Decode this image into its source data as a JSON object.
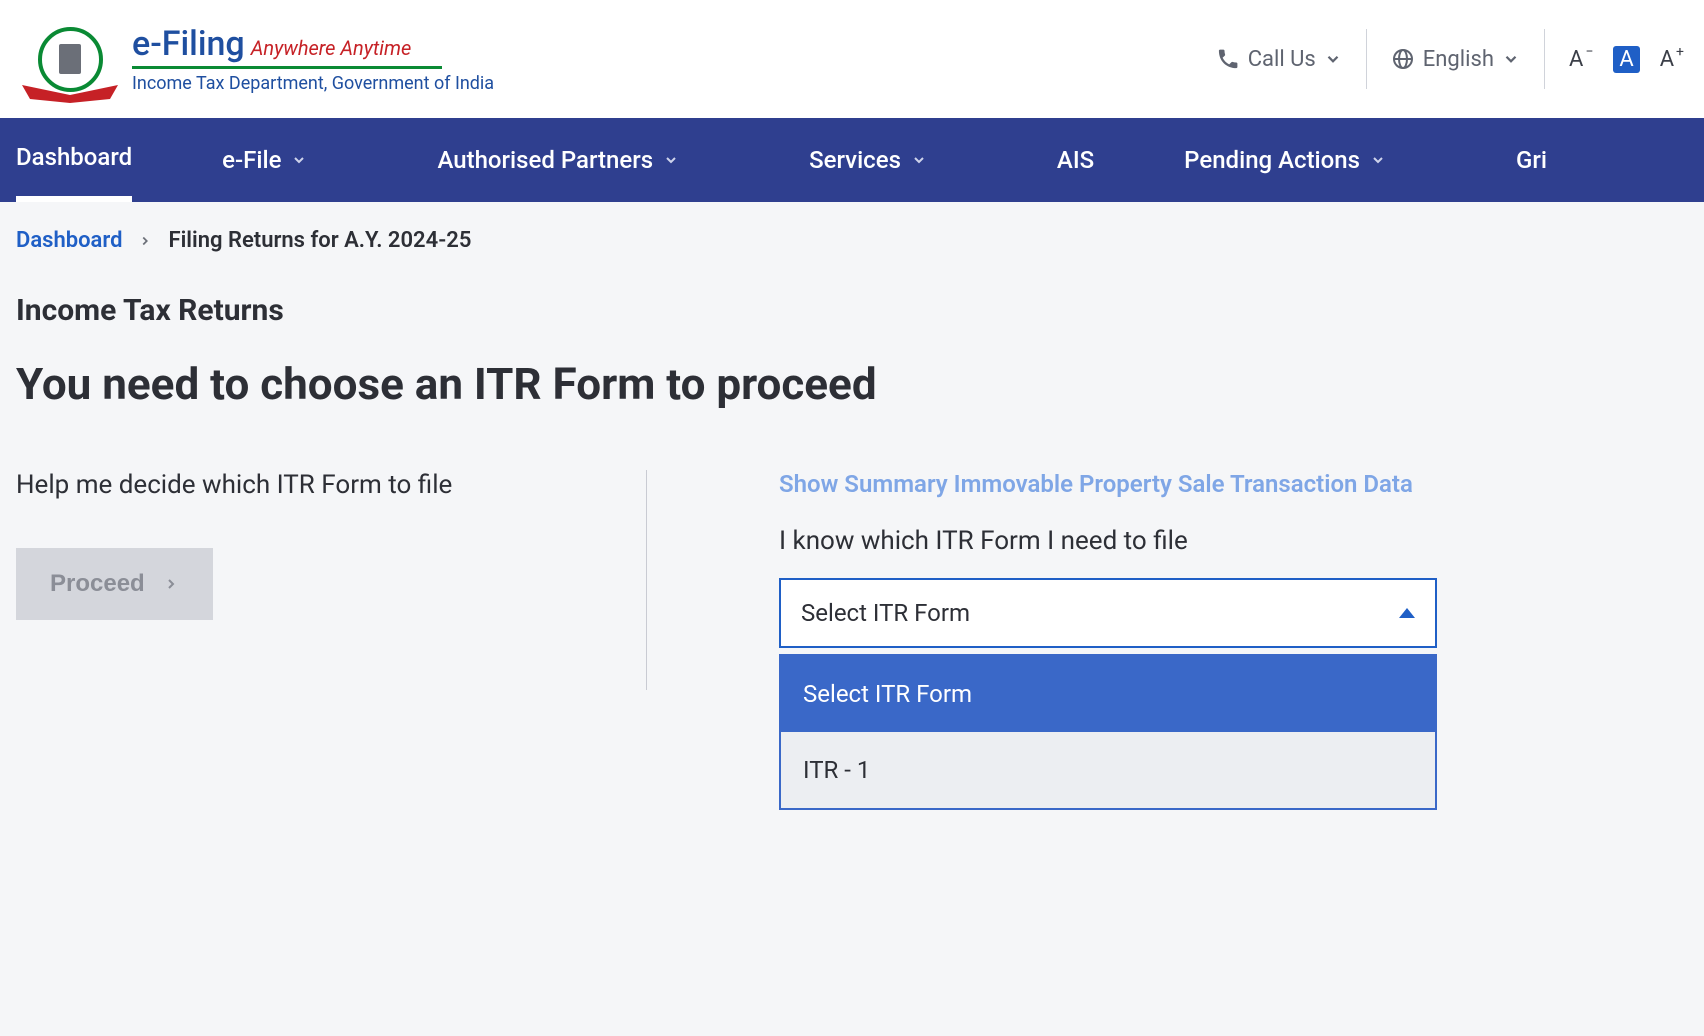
{
  "header": {
    "title_main": "e-Filing",
    "title_tagline": "Anywhere Anytime",
    "subtitle": "Income Tax Department, Government of India",
    "call_us": "Call Us",
    "language": "English",
    "font_small": "A",
    "font_normal": "A",
    "font_large": "A"
  },
  "nav": {
    "dashboard": "Dashboard",
    "efile": "e-File",
    "partners": "Authorised Partners",
    "services": "Services",
    "ais": "AIS",
    "pending": "Pending Actions",
    "grievances": "Gri"
  },
  "breadcrumb": {
    "root": "Dashboard",
    "current": "Filing Returns for A.Y. 2024-25"
  },
  "page": {
    "section_title": "Income Tax Returns",
    "heading": "You need to choose an ITR Form to proceed",
    "help_text": "Help me decide which ITR Form to file",
    "proceed_label": "Proceed",
    "summary_link": "Show Summary Immovable Property Sale Transaction Data",
    "know_text": "I know which ITR Form I need to file"
  },
  "select": {
    "placeholder": "Select ITR Form",
    "options": [
      {
        "label": "Select ITR Form",
        "selected": true
      },
      {
        "label": "ITR - 1",
        "selected": false
      }
    ]
  }
}
